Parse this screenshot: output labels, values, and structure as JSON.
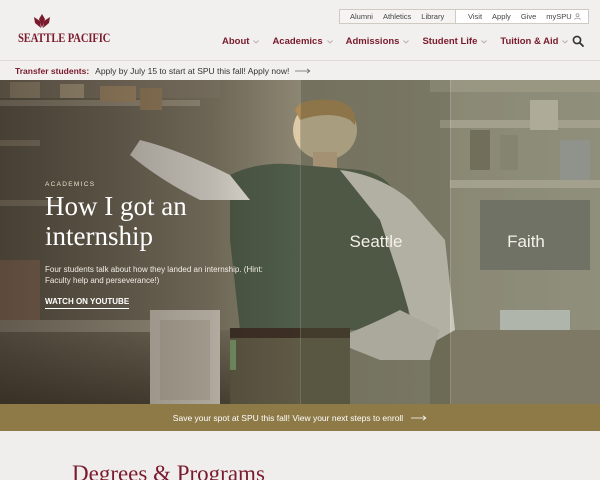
{
  "brand": {
    "logo_text": "SEATTLE PACIFIC",
    "primary_color": "#7a1a2c",
    "gold_color": "#8e7a47"
  },
  "utility_nav": {
    "left": [
      "Alumni",
      "Athletics",
      "Library"
    ],
    "right": [
      "Visit",
      "Apply",
      "Give",
      "mySPU"
    ]
  },
  "main_nav": {
    "items": [
      "About",
      "Academics",
      "Admissions",
      "Student Life",
      "Tuition & Aid"
    ]
  },
  "announcement": {
    "strong": "Transfer students:",
    "message": "Apply by July 15 to start at SPU this fall! Apply now!"
  },
  "hero": {
    "eyebrow": "ACADEMICS",
    "title": "How I got an internship",
    "description": "Four students talk about how they landed an internship. (Hint: Faculty help and perseverance!)",
    "cta": "WATCH ON YOUTUBE",
    "panels": [
      "Seattle",
      "Faith"
    ]
  },
  "enroll_bar": {
    "message": "Save your spot at SPU this fall! View your next steps to enroll"
  },
  "degrees": {
    "title": "Degrees & Programs"
  }
}
